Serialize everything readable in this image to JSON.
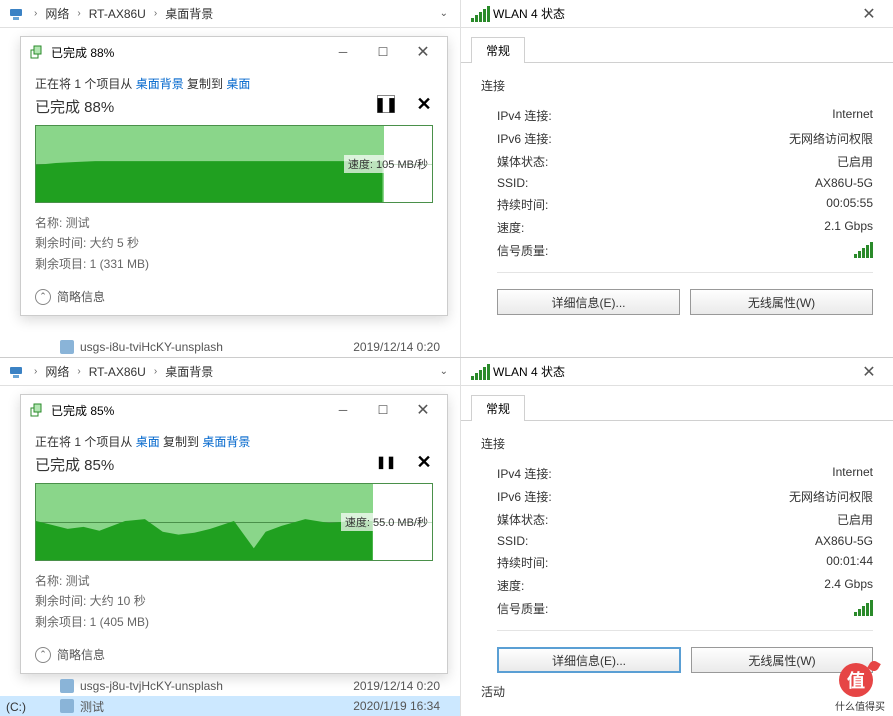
{
  "scenes": [
    {
      "breadcrumb": {
        "items": [
          "网络",
          "RT-AX86U",
          "桌面背景"
        ]
      },
      "copy": {
        "title_percent": "已完成 88%",
        "line_pre": "正在将 1 个项目从 ",
        "src_link": "桌面背景",
        "line_mid": " 复制到 ",
        "dst_link": "桌面",
        "heading": "已完成 88%",
        "speed_label": "速度: 105 MB/秒",
        "fill_pct": 88,
        "pause_char": "❚❚",
        "cancel_char": "✕",
        "name_label": "名称: ",
        "name_val": "测试",
        "remain_time_label": "剩余时间: ",
        "remain_time_val": "大约 5 秒",
        "remain_items_label": "剩余项目: ",
        "remain_items_val": "1 (331 MB)",
        "more_label": "简略信息"
      },
      "files": [
        {
          "name": "usgs-i8u-tviHcKY-unsplash",
          "date": "2019/12/14 0:20",
          "selected": false
        }
      ],
      "wlan": {
        "title": "WLAN 4 状态",
        "tab": "常规",
        "section": "连接",
        "rows": [
          {
            "k": "IPv4 连接:",
            "v": "Internet"
          },
          {
            "k": "IPv6 连接:",
            "v": "无网络访问权限"
          },
          {
            "k": "媒体状态:",
            "v": "已启用"
          },
          {
            "k": "SSID:",
            "v": "AX86U-5G"
          },
          {
            "k": "持续时间:",
            "v": "00:05:55"
          },
          {
            "k": "速度:",
            "v": "2.1 Gbps"
          }
        ],
        "signal_label": "信号质量:",
        "btn_details": "详细信息(E)...",
        "btn_props": "无线属性(W)",
        "focus_btn": ""
      },
      "chart_data": {
        "type": "area",
        "ylabel": "MB/秒",
        "ylim": [
          0,
          200
        ],
        "x": [
          0,
          1,
          2,
          3,
          4,
          5,
          6,
          7,
          8,
          9,
          10,
          11,
          12,
          13,
          14,
          15,
          16,
          17,
          18,
          19
        ],
        "values": [
          95,
          100,
          102,
          103,
          104,
          105,
          105,
          105,
          105,
          105,
          105,
          105,
          105,
          105,
          105,
          105,
          105,
          105,
          0,
          0
        ],
        "progress_pct": 88,
        "current_speed": 105
      }
    },
    {
      "breadcrumb": {
        "items": [
          "网络",
          "RT-AX86U",
          "桌面背景"
        ]
      },
      "copy": {
        "title_percent": "已完成 85%",
        "line_pre": "正在将 1 个项目从 ",
        "src_link": "桌面",
        "line_mid": " 复制到 ",
        "dst_link": "桌面背景",
        "heading": "已完成 85%",
        "speed_label": "速度: 55.0 MB/秒",
        "fill_pct": 85,
        "pause_char": "❚❚",
        "cancel_char": "✕",
        "name_label": "名称: ",
        "name_val": "测试",
        "remain_time_label": "剩余时间: ",
        "remain_time_val": "大约 10 秒",
        "remain_items_label": "剩余项目: ",
        "remain_items_val": "1 (405 MB)",
        "more_label": "简略信息"
      },
      "files": [
        {
          "name": "usgs-j8u-tvjHcKY-unsplash",
          "date": "2019/12/14 0:20",
          "selected": false
        },
        {
          "name": "测试",
          "date": "2020/1/19 16:34",
          "selected": true
        }
      ],
      "drive_label": "(C:)",
      "wlan": {
        "title": "WLAN 4 状态",
        "tab": "常规",
        "section": "连接",
        "rows": [
          {
            "k": "IPv4 连接:",
            "v": "Internet"
          },
          {
            "k": "IPv6 连接:",
            "v": "无网络访问权限"
          },
          {
            "k": "媒体状态:",
            "v": "已启用"
          },
          {
            "k": "SSID:",
            "v": "AX86U-5G"
          },
          {
            "k": "持续时间:",
            "v": "00:01:44"
          },
          {
            "k": "速度:",
            "v": "2.4 Gbps"
          }
        ],
        "signal_label": "信号质量:",
        "btn_details": "详细信息(E)...",
        "btn_props": "无线属性(W)",
        "focus_btn": "details",
        "activity_label": "活动"
      },
      "chart_data": {
        "type": "area",
        "ylabel": "MB/秒",
        "ylim": [
          0,
          110
        ],
        "x": [
          0,
          1,
          2,
          3,
          4,
          5,
          6,
          7,
          8,
          9,
          10,
          11,
          12,
          13,
          14,
          15,
          16,
          17,
          18,
          19
        ],
        "values": [
          58,
          52,
          48,
          50,
          46,
          55,
          58,
          45,
          42,
          44,
          48,
          55,
          18,
          45,
          52,
          58,
          54,
          55,
          0,
          0
        ],
        "progress_pct": 85,
        "current_speed": 55.0
      }
    }
  ],
  "logo": {
    "char": "值",
    "text": "什么值得买"
  }
}
